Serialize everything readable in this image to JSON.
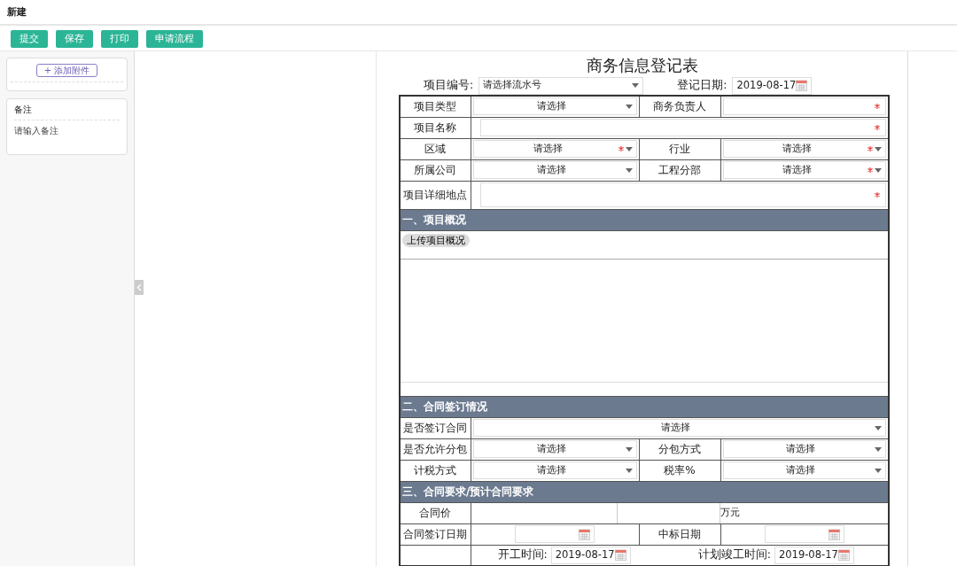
{
  "page_title": "新建",
  "toolbar": [
    "提交",
    "保存",
    "打印",
    "申请流程"
  ],
  "attachments": {
    "button": "+ 添加附件"
  },
  "remarks": {
    "label": "备注",
    "placeholder": "请输入备注"
  },
  "form": {
    "title": "商务信息登记表",
    "header_fields": [
      {
        "label": "项目编号:",
        "kind": "select",
        "value": "请选择流水号"
      },
      {
        "label": "登记日期:",
        "kind": "date",
        "value": "2019-08-17"
      }
    ],
    "rows": [
      {
        "kind": "pair",
        "cells": [
          {
            "label": "项目类型",
            "kind": "select",
            "value": "请选择",
            "required": false
          },
          {
            "label": "商务负责人",
            "kind": "text",
            "required": true
          }
        ]
      },
      {
        "kind": "wide",
        "cells": [
          {
            "label": "项目名称",
            "kind": "text",
            "required": true
          }
        ]
      },
      {
        "kind": "pair",
        "cells": [
          {
            "label": "区域",
            "kind": "select",
            "value": "请选择",
            "required": true
          },
          {
            "label": "行业",
            "kind": "select",
            "value": "请选择",
            "required": true
          }
        ]
      },
      {
        "kind": "pair",
        "cells": [
          {
            "label": "所属公司",
            "kind": "select",
            "value": "请选择",
            "required": false
          },
          {
            "label": "工程分部",
            "kind": "select",
            "value": "请选择",
            "required": true
          }
        ]
      },
      {
        "kind": "wide_tall",
        "cells": [
          {
            "label": "项目详细地点",
            "kind": "text",
            "required": true
          }
        ]
      },
      {
        "kind": "section",
        "title": "一、项目概况"
      },
      {
        "kind": "upload",
        "button": "上传项目概况"
      },
      {
        "kind": "section",
        "title": "二、合同签订情况"
      },
      {
        "kind": "wide",
        "cells": [
          {
            "label": "是否签订合同",
            "kind": "select",
            "value": "请选择",
            "required": false
          }
        ]
      },
      {
        "kind": "pair",
        "cells": [
          {
            "label": "是否允许分包",
            "kind": "select",
            "value": "请选择",
            "required": false
          },
          {
            "label": "分包方式",
            "kind": "select",
            "value": "请选择",
            "required": false
          }
        ]
      },
      {
        "kind": "pair",
        "cells": [
          {
            "label": "计税方式",
            "kind": "select",
            "value": "请选择",
            "required": false
          },
          {
            "label": "税率%",
            "kind": "select",
            "value": "请选择",
            "required": false
          }
        ]
      },
      {
        "kind": "section",
        "title": "三、合同要求/预计合同要求"
      },
      {
        "kind": "price",
        "label": "合同价",
        "unit": "万元"
      },
      {
        "kind": "pair",
        "cells": [
          {
            "label": "合同签订日期",
            "kind": "date",
            "required": false
          },
          {
            "label": "中标日期",
            "kind": "date",
            "required": false
          }
        ]
      },
      {
        "kind": "period",
        "fields": [
          {
            "label": "开工时间:",
            "value": "2019-08-17"
          },
          {
            "label": "计划竣工时间:",
            "value": "2019-08-17"
          }
        ]
      }
    ]
  }
}
